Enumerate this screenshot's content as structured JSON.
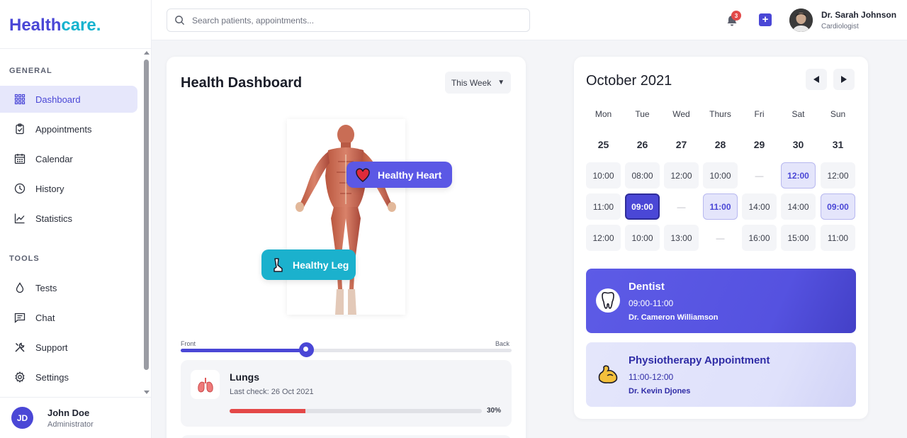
{
  "brand": {
    "part1": "Health",
    "part2": "care",
    "dot": "."
  },
  "sidebar": {
    "general_label": "GENERAL",
    "tools_label": "TOOLS",
    "general_items": [
      {
        "label": "Dashboard",
        "icon": "grid-icon",
        "active": true
      },
      {
        "label": "Appointments",
        "icon": "clipboard-icon"
      },
      {
        "label": "Calendar",
        "icon": "calendar-icon"
      },
      {
        "label": "History",
        "icon": "clock-icon"
      },
      {
        "label": "Statistics",
        "icon": "chart-icon"
      }
    ],
    "tools_items": [
      {
        "label": "Tests",
        "icon": "drop-icon"
      },
      {
        "label": "Chat",
        "icon": "chat-icon"
      },
      {
        "label": "Support",
        "icon": "tools-icon"
      },
      {
        "label": "Settings",
        "icon": "gear-icon"
      }
    ],
    "user": {
      "initials": "JD",
      "name": "John Doe",
      "role": "Administrator"
    }
  },
  "header": {
    "search_placeholder": "Search patients, appointments...",
    "notification_count": "3",
    "doctor_name": "Dr. Sarah Johnson",
    "doctor_role": "Cardiologist"
  },
  "dashboard": {
    "title": "Health Dashboard",
    "period": "This Week",
    "tags": {
      "heart": "Healthy Heart",
      "leg": "Healthy Leg"
    },
    "slider": {
      "left": "Front",
      "right": "Back",
      "value": 0.38
    },
    "organ": {
      "name": "Lungs",
      "last_check": "Last check: 26 Oct 2021",
      "progress": 0.3,
      "progress_label": "30%"
    }
  },
  "calendar": {
    "title": "October 2021",
    "days": [
      "Mon",
      "Tue",
      "Wed",
      "Thurs",
      "Fri",
      "Sat",
      "Sun"
    ],
    "dates": [
      "25",
      "26",
      "27",
      "28",
      "29",
      "30",
      "31"
    ],
    "slots": [
      [
        {
          "t": "10:00"
        },
        {
          "t": "11:00"
        },
        {
          "t": "12:00"
        }
      ],
      [
        {
          "t": "08:00"
        },
        {
          "t": "09:00",
          "s": "selected"
        },
        {
          "t": "10:00"
        }
      ],
      [
        {
          "t": "12:00"
        },
        {
          "t": "—",
          "s": "empty"
        },
        {
          "t": "13:00"
        }
      ],
      [
        {
          "t": "10:00"
        },
        {
          "t": "11:00",
          "s": "avail"
        },
        {
          "t": "—",
          "s": "empty"
        }
      ],
      [
        {
          "t": "—",
          "s": "empty"
        },
        {
          "t": "14:00"
        },
        {
          "t": "16:00"
        }
      ],
      [
        {
          "t": "12:00",
          "s": "avail"
        },
        {
          "t": "14:00"
        },
        {
          "t": "15:00"
        }
      ],
      [
        {
          "t": "12:00"
        },
        {
          "t": "09:00",
          "s": "avail"
        },
        {
          "t": "11:00"
        }
      ]
    ],
    "appointments": [
      {
        "title": "Dentist",
        "time": "09:00-11:00",
        "doctor": "Dr. Cameron Williamson",
        "icon": "tooth-icon"
      },
      {
        "title": "Physiotherapy Appointment",
        "time": "11:00-12:00",
        "doctor": "Dr. Kevin Djones",
        "icon": "flexed-arm-icon"
      }
    ]
  }
}
